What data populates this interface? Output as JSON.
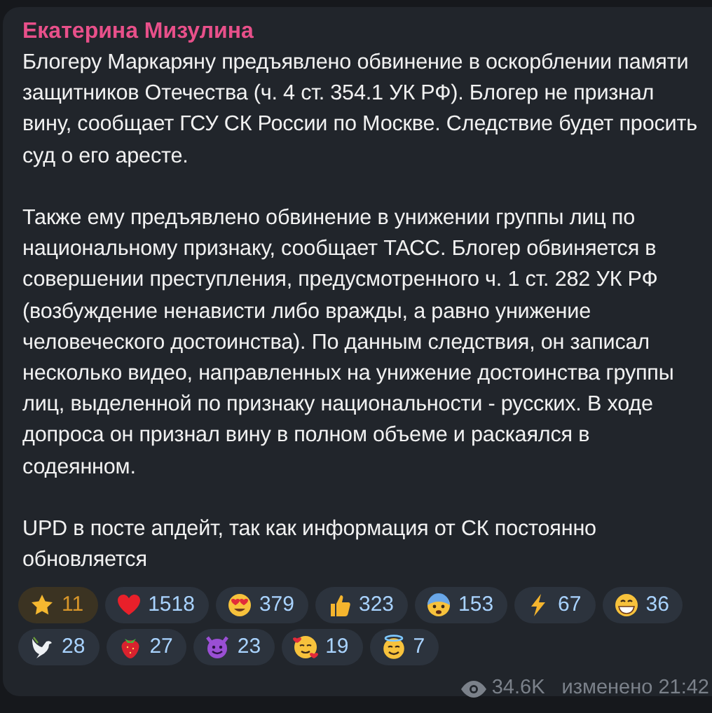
{
  "message": {
    "author": "Екатерина Мизулина",
    "paragraphs": [
      "Блогеру Маркаряну предъявлено обвинение в оскорблении памяти защитников Отечества (ч. 4 ст. 354.1 УК РФ). Блогер не признал вину, сообщает ГСУ СК России по Москве. Следствие будет просить суд о его аресте.",
      "Также ему предъявлено обвинение в унижении группы лиц по национальному признаку, сообщает ТАСС. Блогер обвиняется в совершении преступления, предусмотренного ч. 1 ст. 282 УК РФ (возбуждение ненависти либо вражды, а равно унижение человеческого достоинства). По данным следствия, он записал несколько видео, направленных на унижение достоинства группы лиц, выделенной по признаку национальности - русских. В ходе допроса он признал вину в полном объеме и раскаялся в содеянном.",
      "UPD в посте апдейт, так как информация от СК постоянно обновляется"
    ],
    "reactions": [
      {
        "kind": "star",
        "count": "11",
        "selected": true
      },
      {
        "kind": "heart",
        "count": "1518",
        "selected": false
      },
      {
        "kind": "hearteyes",
        "count": "379",
        "selected": false
      },
      {
        "kind": "thumbsup",
        "count": "323",
        "selected": false
      },
      {
        "kind": "fearful",
        "count": "153",
        "selected": false
      },
      {
        "kind": "lightning",
        "count": "67",
        "selected": false
      },
      {
        "kind": "grin",
        "count": "36",
        "selected": false
      },
      {
        "kind": "dove",
        "count": "28",
        "selected": false
      },
      {
        "kind": "strawberry",
        "count": "27",
        "selected": false
      },
      {
        "kind": "devil",
        "count": "23",
        "selected": false
      },
      {
        "kind": "hearts",
        "count": "19",
        "selected": false
      },
      {
        "kind": "halo",
        "count": "7",
        "selected": false
      }
    ],
    "views": "34.6K",
    "edited": "изменено 21:42"
  }
}
